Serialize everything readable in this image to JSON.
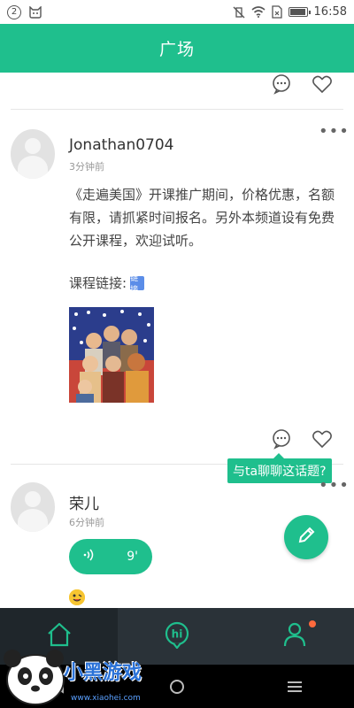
{
  "status_bar": {
    "notification_count": "2",
    "time": "16:58"
  },
  "header": {
    "title": "广场"
  },
  "posts": [
    {
      "username": "Jonathan0704",
      "time_ago": "3分钟前",
      "content": "《走遍美国》开课推广期间，价格优惠，名额有限，请抓紧时间报名。另外本频道设有免费公开课程，欢迎试听。",
      "link_label": "课程链接:",
      "link_icon_text": "链接"
    },
    {
      "username": "荣儿",
      "time_ago": "6分钟前",
      "voice_duration": "9'"
    }
  ],
  "tooltip": {
    "text": "与ta聊聊这话题?"
  },
  "more_menu": "•••",
  "tabs": [
    {
      "name": "home",
      "icon": "home-icon",
      "active": true
    },
    {
      "name": "chat",
      "icon": "hi-bubble-icon",
      "text": "hi",
      "active": false
    },
    {
      "name": "profile",
      "icon": "person-icon",
      "active": false,
      "has_badge": true
    }
  ],
  "watermark": {
    "brand": "小黑游戏",
    "url": "www.xiaohei.com"
  },
  "colors": {
    "accent": "#1fbf8d",
    "tabbar": "#2a3238",
    "badge": "#ff6a3d"
  }
}
